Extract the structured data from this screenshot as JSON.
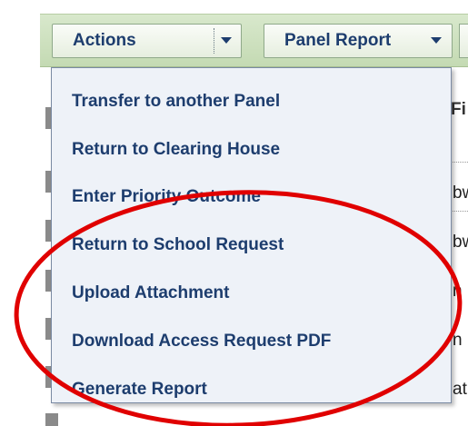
{
  "toolbar": {
    "actions_label": "Actions",
    "panel_report_label": "Panel Report"
  },
  "grid": {
    "column_header_partial": "Fi",
    "row_fragments": [
      "bw",
      "bw",
      "n",
      "n",
      "at"
    ]
  },
  "menu": {
    "items": [
      {
        "label": "Transfer to another Panel"
      },
      {
        "label": "Return to Clearing House"
      },
      {
        "label": "Enter Priority Outcome"
      },
      {
        "label": "Return to School Request"
      },
      {
        "label": "Upload Attachment"
      },
      {
        "label": "Download Access Request PDF"
      },
      {
        "label": "Generate Report"
      }
    ]
  },
  "annotation": {
    "shape": "ellipse",
    "color": "#e00000"
  }
}
